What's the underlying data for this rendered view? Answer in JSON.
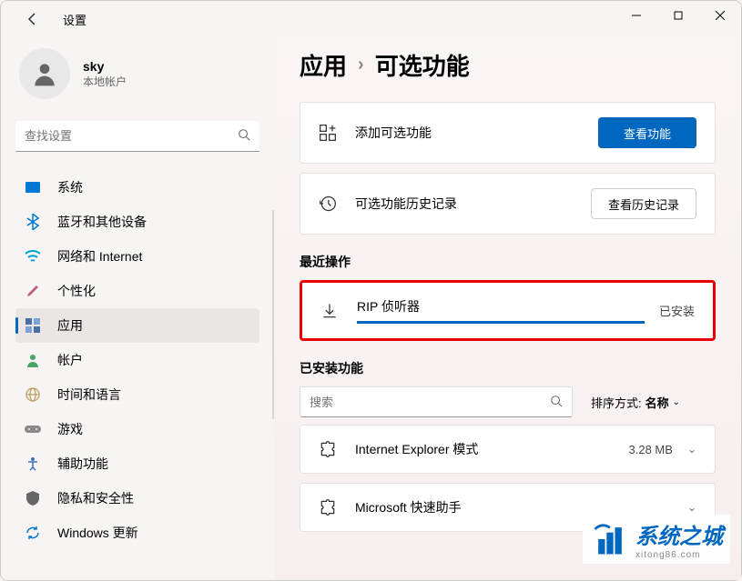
{
  "window": {
    "title": "设置"
  },
  "user": {
    "name": "sky",
    "subtitle": "本地帐户"
  },
  "search": {
    "placeholder": "查找设置"
  },
  "sidebar": {
    "items": [
      {
        "label": "系统",
        "icon": "monitor",
        "color": "#0078d4"
      },
      {
        "label": "蓝牙和其他设备",
        "icon": "bluetooth",
        "color": "#0078d4"
      },
      {
        "label": "网络和 Internet",
        "icon": "wifi",
        "color": "#00a4d6"
      },
      {
        "label": "个性化",
        "icon": "brush",
        "color": "#c06080"
      },
      {
        "label": "应用",
        "icon": "apps",
        "color": "#555"
      },
      {
        "label": "帐户",
        "icon": "person",
        "color": "#4aa564"
      },
      {
        "label": "时间和语言",
        "icon": "globe",
        "color": "#b8a060"
      },
      {
        "label": "游戏",
        "icon": "gamepad",
        "color": "#888"
      },
      {
        "label": "辅助功能",
        "icon": "accessibility",
        "color": "#3a70c4"
      },
      {
        "label": "隐私和安全性",
        "icon": "shield",
        "color": "#666"
      },
      {
        "label": "Windows 更新",
        "icon": "update",
        "color": "#0078d4"
      }
    ]
  },
  "breadcrumb": {
    "parent": "应用",
    "current": "可选功能"
  },
  "cards": {
    "add": {
      "title": "添加可选功能",
      "button": "查看功能"
    },
    "history": {
      "title": "可选功能历史记录",
      "button": "查看历史记录"
    }
  },
  "recent": {
    "label": "最近操作",
    "item": {
      "name": "RIP 侦听器",
      "status": "已安装"
    }
  },
  "installed": {
    "label": "已安装功能",
    "search_placeholder": "搜索",
    "sort_label": "排序方式:",
    "sort_value": "名称",
    "features": [
      {
        "name": "Internet Explorer 模式",
        "size": "3.28 MB"
      },
      {
        "name": "Microsoft 快速助手",
        "size": ""
      }
    ]
  },
  "watermark": {
    "text": "系统之城",
    "sub": "xitong86.com"
  }
}
